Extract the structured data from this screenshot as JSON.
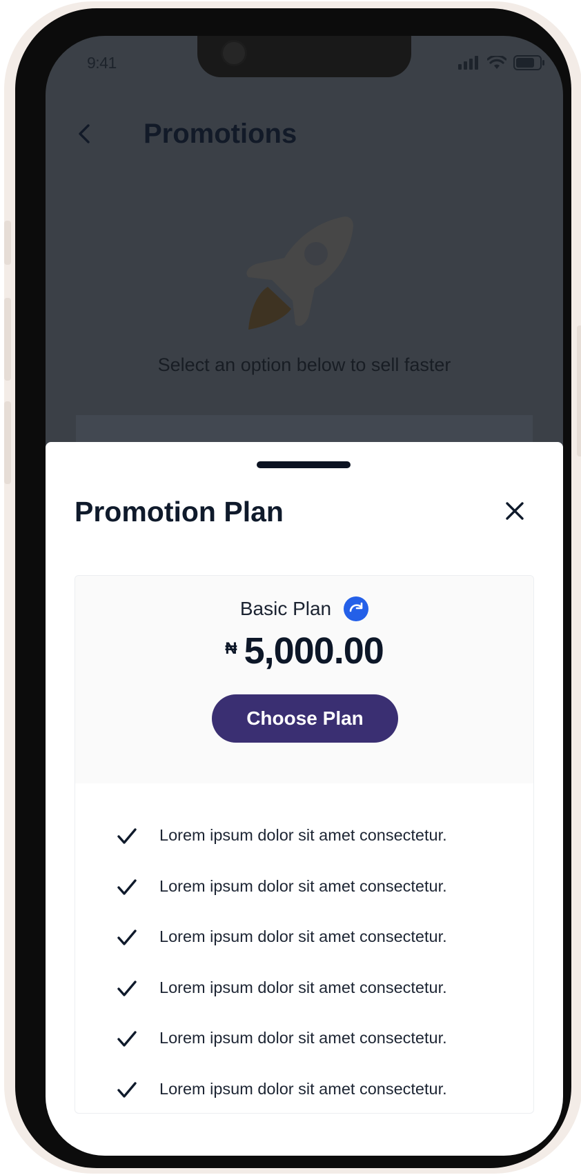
{
  "status_bar": {
    "time": "9:41"
  },
  "header": {
    "title": "Promotions"
  },
  "hero": {
    "subtitle": "Select an option below to sell faster"
  },
  "sheet": {
    "title": "Promotion Plan",
    "plan": {
      "name": "Basic Plan",
      "currency_symbol": "₦",
      "price": "5,000.00",
      "button_label": "Choose Plan"
    },
    "features": [
      "Lorem ipsum dolor sit amet consectetur.",
      "Lorem ipsum dolor sit amet consectetur.",
      "Lorem ipsum dolor sit amet consectetur.",
      "Lorem ipsum dolor sit amet consectetur.",
      "Lorem ipsum dolor sit amet consectetur.",
      "Lorem ipsum dolor sit amet consectetur."
    ]
  },
  "colors": {
    "primary_button": "#3a2f72",
    "accent_blue": "#2460e8",
    "text_dark": "#0f1a2b",
    "overlay": "#3b4047"
  },
  "icons": [
    "back-icon",
    "rocket-icon",
    "close-icon",
    "renew-icon",
    "check-icon",
    "signal-icon",
    "wifi-icon",
    "battery-icon"
  ]
}
